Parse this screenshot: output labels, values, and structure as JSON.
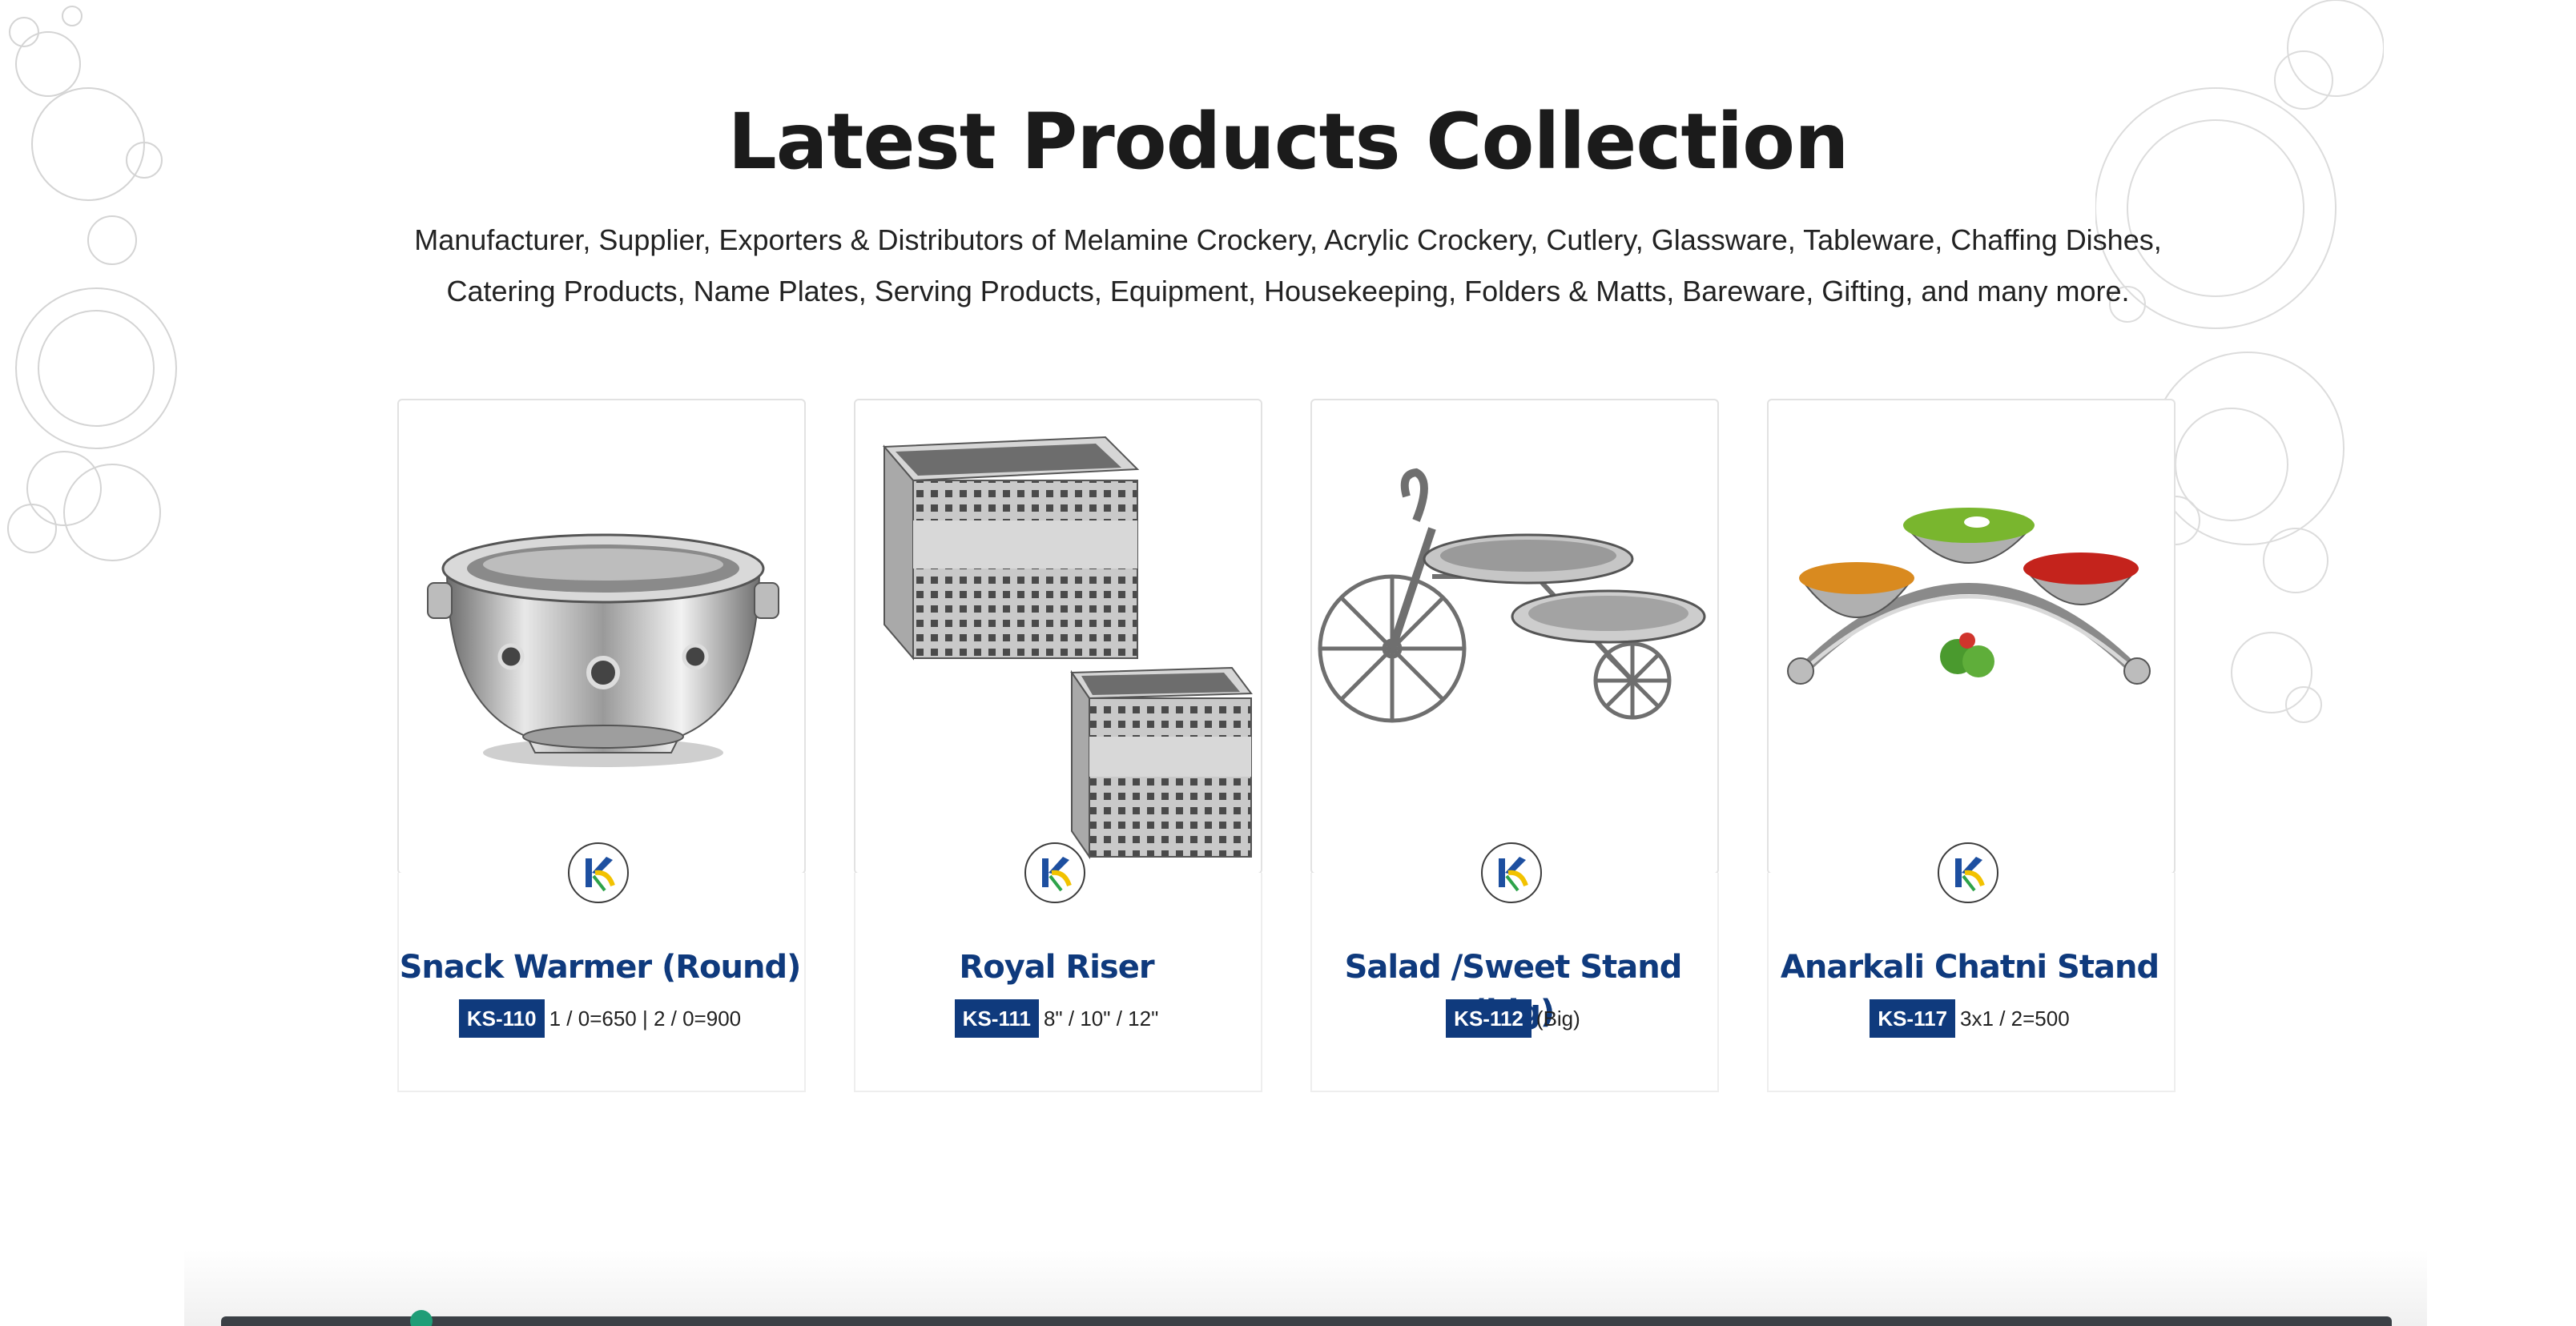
{
  "section": {
    "title": "Latest Products Collection",
    "subtitle": "Manufacturer, Supplier, Exporters & Distributors of Melamine Crockery, Acrylic Crockery, Cutlery, Glassware, Tableware, Chaffing Dishes, Catering Products, Name Plates, Serving Products, Equipment, Housekeeping, Folders & Matts, Bareware, Gifting, and many more."
  },
  "products": [
    {
      "name": "Snack Warmer (Round)",
      "code": "KS-110",
      "detail": "1 / 0=650 | 2 / 0=900",
      "image_icon": "round-snack-warmer-bowl"
    },
    {
      "name": "Royal Riser",
      "code": "KS-111",
      "detail": "8\" / 10\" / 12\"",
      "image_icon": "perforated-square-risers"
    },
    {
      "name": "Salad /Sweet Stand (big)",
      "code": "KS-112",
      "detail": "(Big)",
      "image_icon": "cycle-platter-stand"
    },
    {
      "name": "Anarkali Chatni Stand",
      "code": "KS-117",
      "detail": "3x1 / 2=500",
      "image_icon": "three-bowl-arc-stand"
    }
  ],
  "colors": {
    "accent_blue": "#0f3a7d",
    "title_dark": "#1b1b1b",
    "bar_dark": "#3b4046",
    "dot_green": "#1f9d77"
  }
}
